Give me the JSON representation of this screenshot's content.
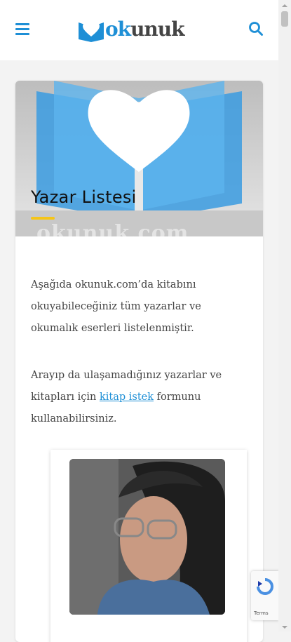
{
  "header": {
    "logo_prefix": "ok",
    "logo_suffix": "unuk"
  },
  "hero": {
    "title": "Yazar Listesi",
    "watermark": "okunuk.com"
  },
  "content": {
    "paragraph1": "Aşağıda okunuk.com’da kitabını okuyabileceğiniz tüm yazarlar ve okumalık eserleri listelenmiştir.",
    "paragraph2_before": "Arayıp da ulaşamadığınız yazarlar ve kitapları için ",
    "paragraph2_link": "kitap istek",
    "paragraph2_after": " formunu kullanabilirsiniz."
  },
  "recaptcha": {
    "terms": "Terms"
  },
  "colors": {
    "brand": "#1e8fd6",
    "accent_bar": "#f5c518"
  }
}
